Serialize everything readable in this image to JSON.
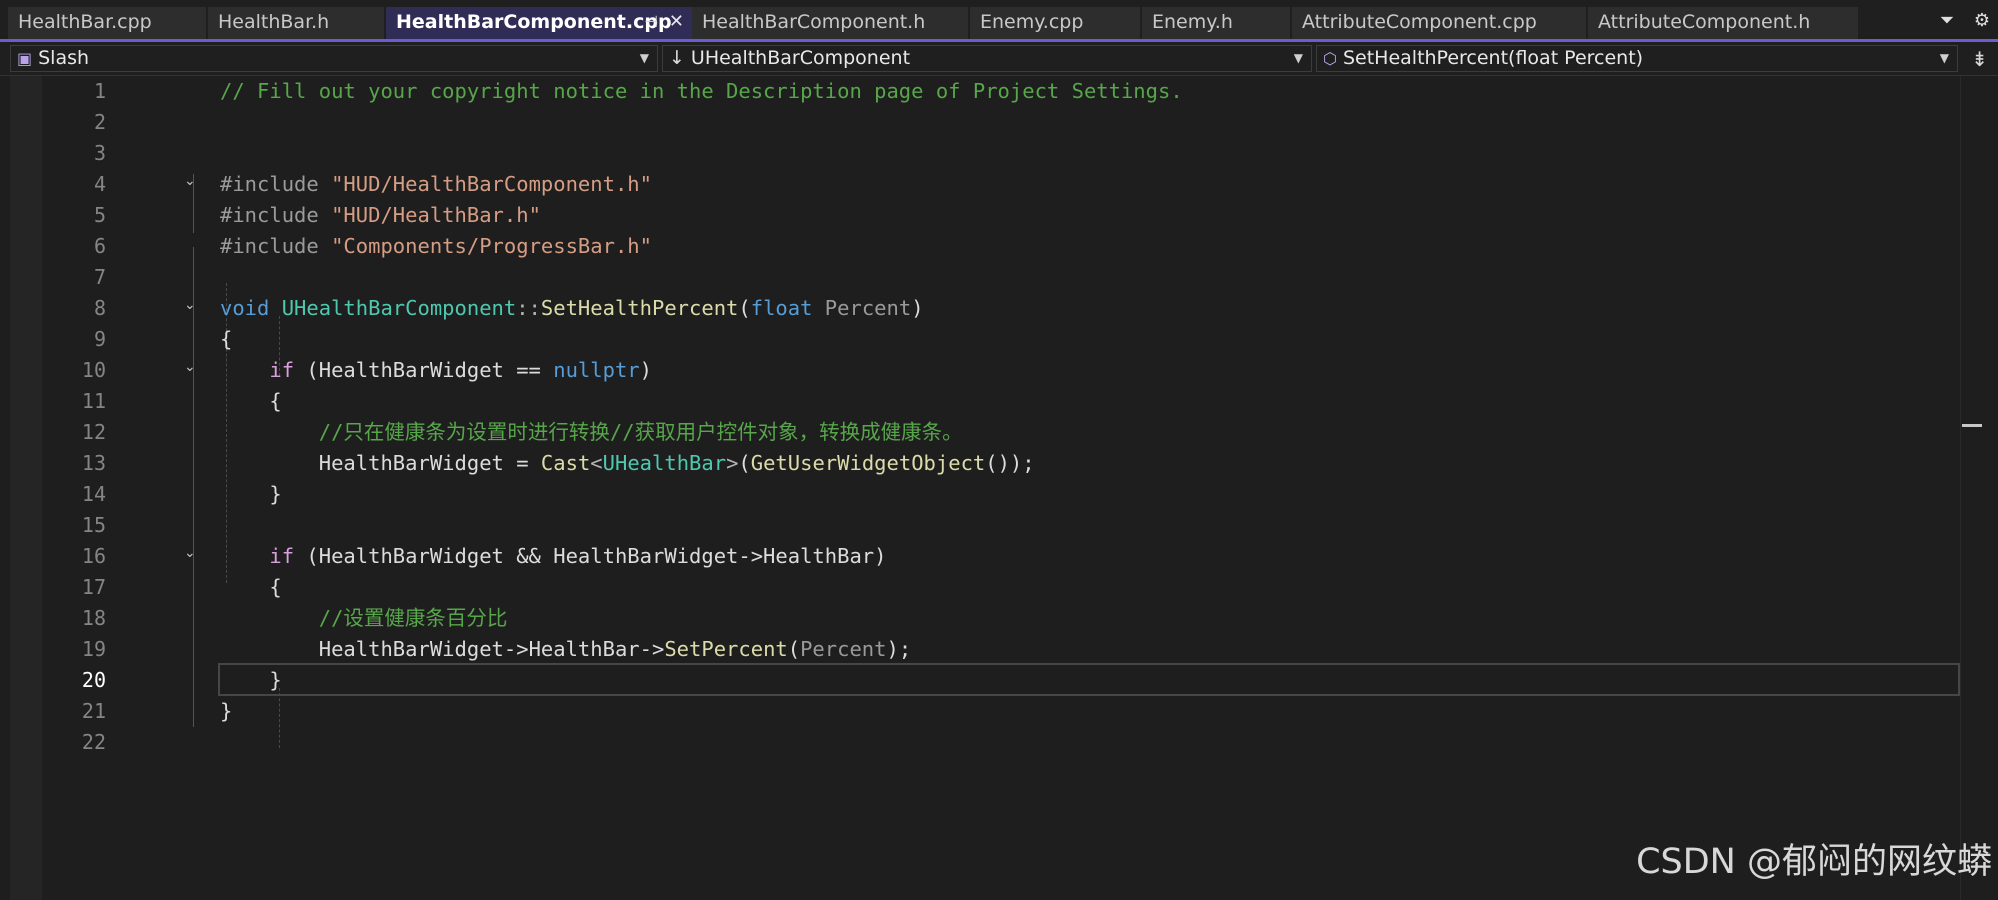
{
  "tabs": [
    {
      "label": "HealthBar.cpp"
    },
    {
      "label": "HealthBar.h"
    },
    {
      "label": "HealthBarComponent.cpp",
      "active": true
    },
    {
      "label": "HealthBarComponent.h"
    },
    {
      "label": "Enemy.cpp"
    },
    {
      "label": "Enemy.h"
    },
    {
      "label": "AttributeComponent.cpp"
    },
    {
      "label": "AttributeComponent.h"
    }
  ],
  "tab_pin_glyph": "⊣",
  "tab_close_glyph": "✕",
  "navbar": {
    "project": "Slash",
    "scope": "UHealthBarComponent",
    "member": "SetHealthPercent(float Percent)"
  },
  "current_line": 20,
  "code": {
    "l1": "// Fill out your copyright notice in the Description page of Project Settings.",
    "l4_pre": "#include ",
    "l4_str": "\"HUD/HealthBarComponent.h\"",
    "l5_pre": "#include ",
    "l5_str": "\"HUD/HealthBar.h\"",
    "l6_pre": "#include ",
    "l6_str": "\"Components/ProgressBar.h\"",
    "l8_void": "void",
    "l8_class": "UHealthBarComponent",
    "l8_sep": "::",
    "l8_fn": "SetHealthPercent",
    "l8_open": "(",
    "l8_type": "float",
    "l8_param": "Percent",
    "l8_close": ")",
    "brace_open": "{",
    "brace_close": "}",
    "l10_if": "if",
    "l10_a": " (HealthBarWidget == ",
    "l10_null": "nullptr",
    "l10_b": ")",
    "l12_comment": "//只在健康条为设置时进行转换//获取用户控件对象，转换成健康条。",
    "l13_a": "HealthBarWidget = ",
    "l13_cast": "Cast",
    "l13_lt": "<",
    "l13_type": "UHealthBar",
    "l13_gt": ">",
    "l13_b": "(",
    "l13_fn": "GetUserWidgetObject",
    "l13_c": "());",
    "l16_if": "if",
    "l16_a": " (HealthBarWidget && HealthBarWidget->HealthBar)",
    "l18_comment": "//设置健康条百分比",
    "l19_a": "HealthBarWidget->HealthBar->",
    "l19_fn": "SetPercent",
    "l19_b": "(",
    "l19_param": "Percent",
    "l19_c": ");"
  },
  "line_numbers": [
    "1",
    "2",
    "3",
    "4",
    "5",
    "6",
    "7",
    "8",
    "9",
    "10",
    "11",
    "12",
    "13",
    "14",
    "15",
    "16",
    "17",
    "18",
    "19",
    "20",
    "21",
    "22"
  ],
  "watermark": "CSDN @郁闷的网纹蟒",
  "icons": {
    "project": "project-icon",
    "scope": "down-arrow-icon",
    "member": "method-cube-icon",
    "fold": "chevron-down-icon",
    "split": "split-editor-icon",
    "settings": "gear-icon",
    "overflow": "tab-overflow-icon"
  },
  "colors": {
    "accent": "#6d5bd0",
    "comment": "#57a64a",
    "string": "#d69d85",
    "keyword": "#569cd6",
    "control": "#d8a0df",
    "type": "#4ec9b0",
    "function": "#dcdcaa"
  }
}
